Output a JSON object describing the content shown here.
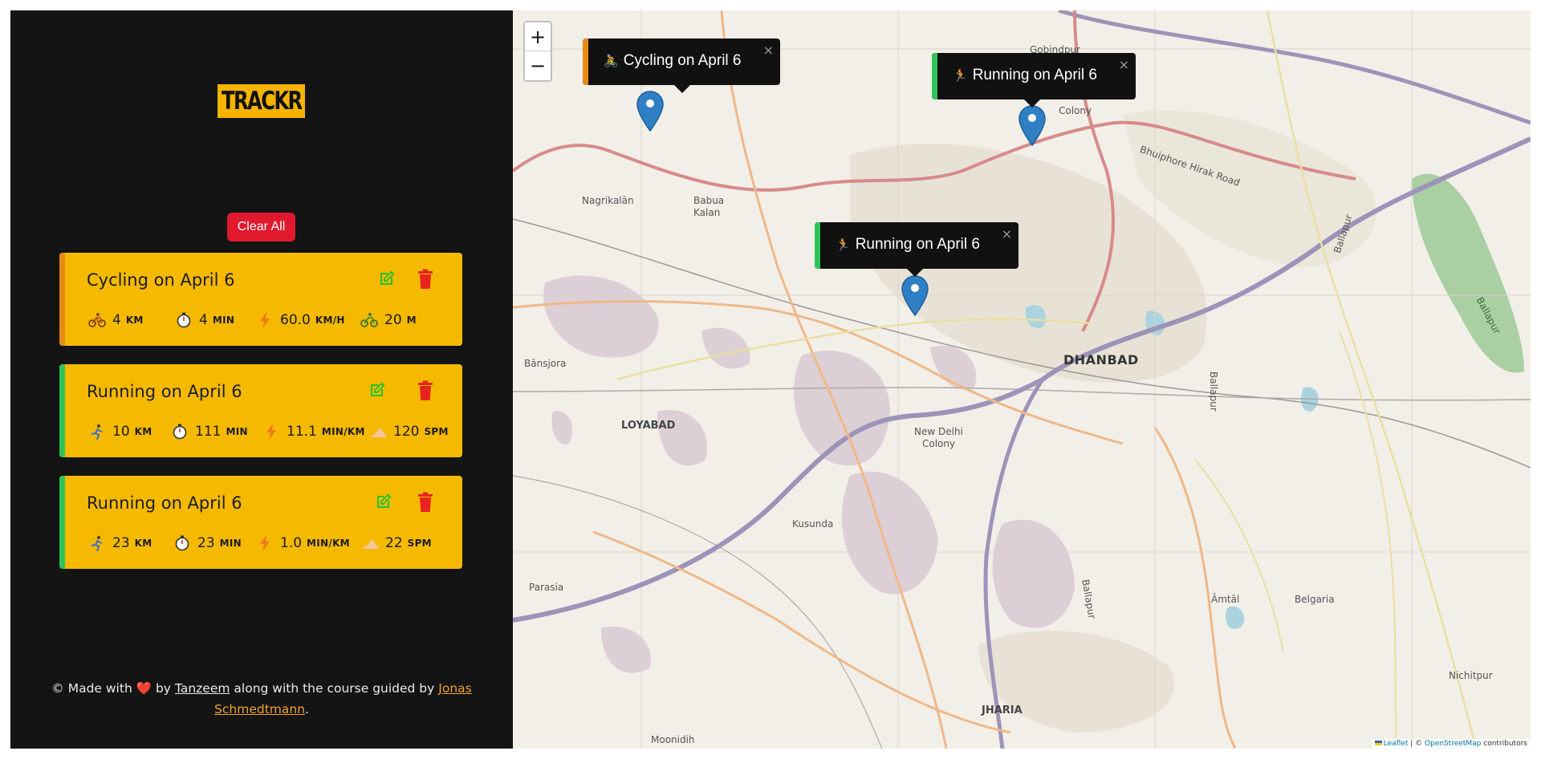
{
  "app": {
    "logo_text": "TRACKR"
  },
  "sidebar": {
    "clear_all_label": "Clear All",
    "workouts": [
      {
        "title": "Cycling on April 6",
        "type": "cycling",
        "bar_color": "#e88a1a",
        "stats": [
          {
            "icon": "bicycle-icon",
            "value": "4",
            "unit": "KM"
          },
          {
            "icon": "stopwatch-icon",
            "value": "4",
            "unit": "MIN"
          },
          {
            "icon": "lightning-icon",
            "value": "60.0",
            "unit": "KM/H"
          },
          {
            "icon": "mountain-bike-icon",
            "value": "20",
            "unit": "M"
          }
        ]
      },
      {
        "title": "Running on April 6",
        "type": "running",
        "bar_color": "#2fc45a",
        "stats": [
          {
            "icon": "runner-icon",
            "value": "10",
            "unit": "KM"
          },
          {
            "icon": "stopwatch-icon",
            "value": "111",
            "unit": "MIN"
          },
          {
            "icon": "lightning-icon",
            "value": "11.1",
            "unit": "MIN/KM"
          },
          {
            "icon": "footprint-icon",
            "value": "120",
            "unit": "SPM"
          }
        ]
      },
      {
        "title": "Running on April 6",
        "type": "running",
        "bar_color": "#2fc45a",
        "stats": [
          {
            "icon": "runner-icon",
            "value": "23",
            "unit": "KM"
          },
          {
            "icon": "stopwatch-icon",
            "value": "23",
            "unit": "MIN"
          },
          {
            "icon": "lightning-icon",
            "value": "1.0",
            "unit": "MIN/KM"
          },
          {
            "icon": "footprint-icon",
            "value": "22",
            "unit": "SPM"
          }
        ]
      }
    ],
    "footer": {
      "prefix": "© Made with",
      "heart": "❤️",
      "by": "by",
      "author": "Tanzeem",
      "middle": "along with the course guided by",
      "mentor_first": "Jonas",
      "mentor_last": "Schmedtmann",
      "suffix": "."
    }
  },
  "map": {
    "zoom_in": "+",
    "zoom_out": "−",
    "popups": [
      {
        "text": "Cycling on April 6",
        "emoji": "🚴",
        "close": "×",
        "bar_color": "#e88a1a"
      },
      {
        "text": "Running on April 6",
        "emoji": "🏃",
        "close": "×",
        "bar_color": "#2fc45a"
      },
      {
        "text": "Running on April 6",
        "emoji": "🏃",
        "close": "×",
        "bar_color": "#2fc45a"
      }
    ],
    "labels": {
      "dhanbad": "DHANBAD",
      "loyabad": "LOYABAD",
      "jharia": "JHARIA",
      "nagrikalan": "Nagrikalān",
      "babua_kalan_1": "Babua",
      "babua_kalan_2": "Kalan",
      "bansjora": "Bānsjora",
      "new_delhi_1": "New Delhi",
      "new_delhi_2": "Colony",
      "kusunda": "Kusunda",
      "parasia": "Parasia",
      "moonidih": "Moonidih",
      "amtal": "Āmtāl",
      "belgaria": "Belgaria",
      "nichitpur": "Nichitpur",
      "gobindpur": "Gobindpur",
      "colony": "Colony",
      "bhuiphore": "Bhuiphore Hirak Road",
      "ballapur_1": "Ballapur",
      "ballapur_2": "Ballapur",
      "ballapur_3": "Ballapur",
      "ballapur_4": "Ballapur"
    },
    "attribution": {
      "leaflet": "Leaflet",
      "separator": " | © ",
      "osm": "OpenStreetMap",
      "contributors": " contributors"
    }
  }
}
